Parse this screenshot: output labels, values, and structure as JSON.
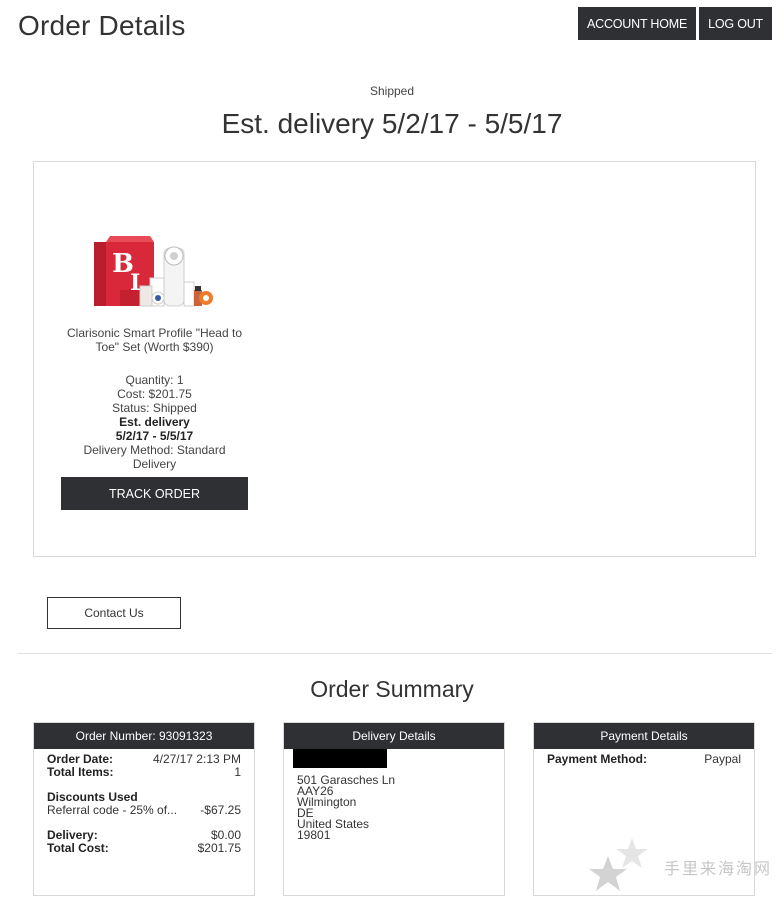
{
  "header": {
    "title": "Order Details",
    "account_home": "ACCOUNT HOME",
    "log_out": "LOG OUT"
  },
  "shipment": {
    "status": "Shipped",
    "estimate": "Est. delivery 5/2/17 - 5/5/17"
  },
  "item": {
    "name": "Clarisonic Smart Profile \"Head to Toe\" Set (Worth $390)",
    "quantity": "Quantity: 1",
    "cost": "Cost: $201.75",
    "status": "Status: Shipped",
    "est_label": "Est. delivery",
    "est_range": "5/2/17 - 5/5/17",
    "delivery_method": "Delivery Method: Standard Delivery",
    "track_button": "TRACK ORDER"
  },
  "contact_button": "Contact Us",
  "summary": {
    "heading": "Order Summary",
    "order_card": {
      "header": "Order Number: 93091323",
      "order_date_label": "Order Date:",
      "order_date_value": "4/27/17 2:13 PM",
      "total_items_label": "Total Items:",
      "total_items_value": "1",
      "discounts_label": "Discounts Used",
      "discount_name": "Referral code - 25% of...",
      "discount_value": "-$67.25",
      "delivery_label": "Delivery:",
      "delivery_value": "$0.00",
      "total_cost_label": "Total Cost:",
      "total_cost_value": "$201.75"
    },
    "delivery_card": {
      "header": "Delivery Details",
      "address": [
        "501 Garasches Ln",
        "AAY26",
        "Wilmington",
        "DE",
        "United States",
        "19801"
      ]
    },
    "payment_card": {
      "header": "Payment Details",
      "method_label": "Payment Method:",
      "method_value": "Paypal"
    }
  },
  "watermark": "手里来海淘网",
  "colors": {
    "dark": "#2e3033",
    "product_red": "#d8283a",
    "accent_orange": "#f07a2c"
  }
}
